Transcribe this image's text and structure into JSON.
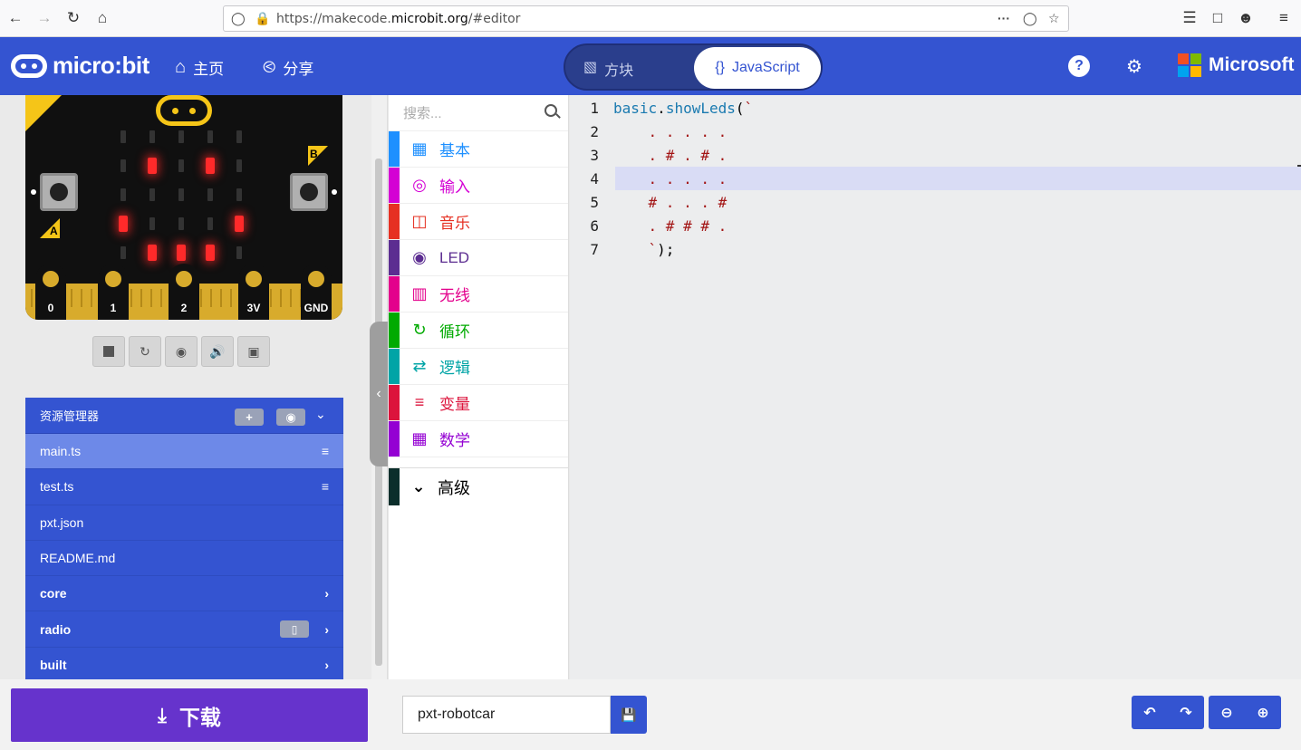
{
  "browser": {
    "url_prefix": "https://makecode.",
    "url_domain": "microbit.org",
    "url_suffix": "/#editor"
  },
  "header": {
    "logo_text": "micro:bit",
    "home_label": "主页",
    "share_label": "分享",
    "mode_blocks": "方块",
    "mode_javascript": "JavaScript",
    "microsoft_label": "Microsoft",
    "colors": {
      "header_bg": "#3454d1",
      "ms_red": "#f25022",
      "ms_green": "#7fba00",
      "ms_blue": "#00a4ef",
      "ms_yellow": "#ffb900"
    }
  },
  "simulator": {
    "pins": [
      "0",
      "1",
      "2",
      "3V",
      "GND"
    ],
    "button_a": "A",
    "button_b": "B",
    "led_matrix": [
      [
        0,
        0,
        0,
        0,
        0
      ],
      [
        0,
        1,
        0,
        1,
        0
      ],
      [
        0,
        0,
        0,
        0,
        0
      ],
      [
        1,
        0,
        0,
        0,
        1
      ],
      [
        0,
        1,
        1,
        1,
        0
      ]
    ],
    "controls": [
      "stop-icon",
      "restart-icon",
      "slow-motion-icon",
      "mute-icon",
      "fullscreen-icon"
    ]
  },
  "explorer": {
    "title": "资源管理器",
    "files": [
      {
        "name": "main.ts",
        "active": true
      },
      {
        "name": "test.ts"
      },
      {
        "name": "pxt.json"
      },
      {
        "name": "README.md"
      },
      {
        "name": "core",
        "folder": true
      },
      {
        "name": "radio",
        "folder": true
      },
      {
        "name": "built",
        "folder": true
      }
    ]
  },
  "toolbox": {
    "search_placeholder": "搜索...",
    "categories": [
      {
        "label": "基本",
        "color": "#1e90ff",
        "icon": "grid-icon"
      },
      {
        "label": "输入",
        "color": "#d400d4",
        "icon": "target-icon"
      },
      {
        "label": "音乐",
        "color": "#e63022",
        "icon": "headphones-icon"
      },
      {
        "label": "LED",
        "color": "#5c2d91",
        "icon": "toggle-icon"
      },
      {
        "label": "无线",
        "color": "#e3008c",
        "icon": "signal-icon"
      },
      {
        "label": "循环",
        "color": "#00aa00",
        "icon": "refresh-icon"
      },
      {
        "label": "逻辑",
        "color": "#00a4a6",
        "icon": "shuffle-icon"
      },
      {
        "label": "变量",
        "color": "#dc143c",
        "icon": "list-icon"
      },
      {
        "label": "数学",
        "color": "#9400d3",
        "icon": "calculator-icon"
      }
    ],
    "advanced_label": "高级",
    "advanced_color": "#0b2e2b"
  },
  "editor": {
    "lines": [
      {
        "n": "1",
        "text": "basic.showLeds(`"
      },
      {
        "n": "2",
        "text": "    . . . . ."
      },
      {
        "n": "3",
        "text": "    . # . # ."
      },
      {
        "n": "4",
        "text": "    . . . . .",
        "highlight": true
      },
      {
        "n": "5",
        "text": "    # . . . #"
      },
      {
        "n": "6",
        "text": "    . # # # ."
      },
      {
        "n": "7",
        "text": "    `);"
      }
    ]
  },
  "bottom": {
    "download_label": "下载",
    "project_name": "pxt-robotcar"
  }
}
